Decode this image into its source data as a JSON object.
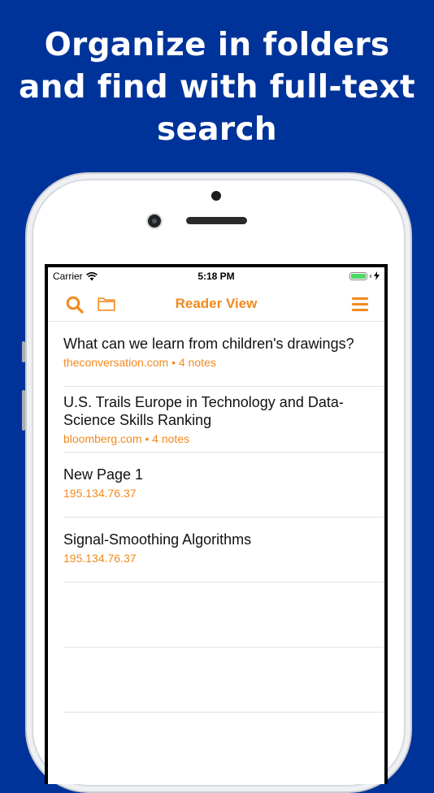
{
  "headline": {
    "line1": "Organize in folders",
    "line2": "and find with full-text",
    "line3": "search"
  },
  "status_bar": {
    "carrier": "Carrier",
    "time": "5:18 PM"
  },
  "nav": {
    "title": "Reader View",
    "search_icon": "search-icon",
    "folder_icon": "folder-icon",
    "menu_icon": "hamburger-menu-icon"
  },
  "items": [
    {
      "title": "What can we learn from children's drawings?",
      "subtitle": "theconversation.com • 4 notes"
    },
    {
      "title": "U.S. Trails Europe in Technology and Data-Science Skills Ranking",
      "subtitle": "bloomberg.com • 4 notes"
    },
    {
      "title": "New Page 1",
      "subtitle": "195.134.76.37"
    },
    {
      "title": "Signal-Smoothing Algorithms",
      "subtitle": "195.134.76.37"
    }
  ],
  "colors": {
    "background": "#003399",
    "accent": "#f28a1e"
  }
}
